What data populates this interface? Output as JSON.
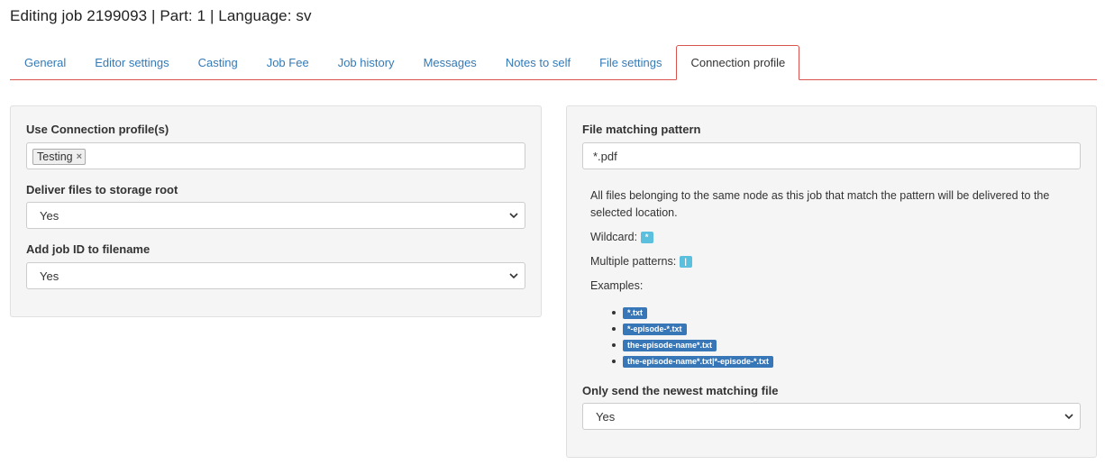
{
  "page": {
    "title": "Editing job 2199093 | Part: 1 | Language: sv"
  },
  "tabs": [
    {
      "label": "General",
      "active": false
    },
    {
      "label": "Editor settings",
      "active": false
    },
    {
      "label": "Casting",
      "active": false
    },
    {
      "label": "Job Fee",
      "active": false
    },
    {
      "label": "Job history",
      "active": false
    },
    {
      "label": "Messages",
      "active": false
    },
    {
      "label": "Notes to self",
      "active": false
    },
    {
      "label": "File settings",
      "active": false
    },
    {
      "label": "Connection profile",
      "active": true
    }
  ],
  "left_panel": {
    "connection_profiles": {
      "label": "Use Connection profile(s)",
      "tokens": [
        {
          "label": "Testing",
          "remove_icon": "×"
        }
      ]
    },
    "deliver_root": {
      "label": "Deliver files to storage root",
      "value": "Yes"
    },
    "add_job_id": {
      "label": "Add job ID to filename",
      "value": "Yes"
    }
  },
  "right_panel": {
    "file_pattern": {
      "label": "File matching pattern",
      "value": "*.pdf"
    },
    "help": {
      "description": "All files belonging to the same node as this job that match the pattern will be delivered to the selected location.",
      "wildcard_label": "Wildcard:",
      "wildcard_badge": "*",
      "multiple_label": "Multiple patterns:",
      "multiple_badge": "|",
      "examples_label": "Examples:",
      "examples": [
        "*.txt",
        "*-episode-*.txt",
        "the-episode-name*.txt",
        "the-episode-name*.txt|*-episode-*.txt"
      ]
    },
    "newest_only": {
      "label": "Only send the newest matching file",
      "value": "Yes"
    }
  },
  "colors": {
    "link": "#337ab7",
    "active_tab_border": "#d9534f",
    "panel_bg": "#f5f5f5",
    "badge_info": "#5bc0de",
    "badge_primary": "#3877b7"
  },
  "icons": {
    "select_caret": "chevron-down-icon",
    "token_remove": "close-icon"
  }
}
